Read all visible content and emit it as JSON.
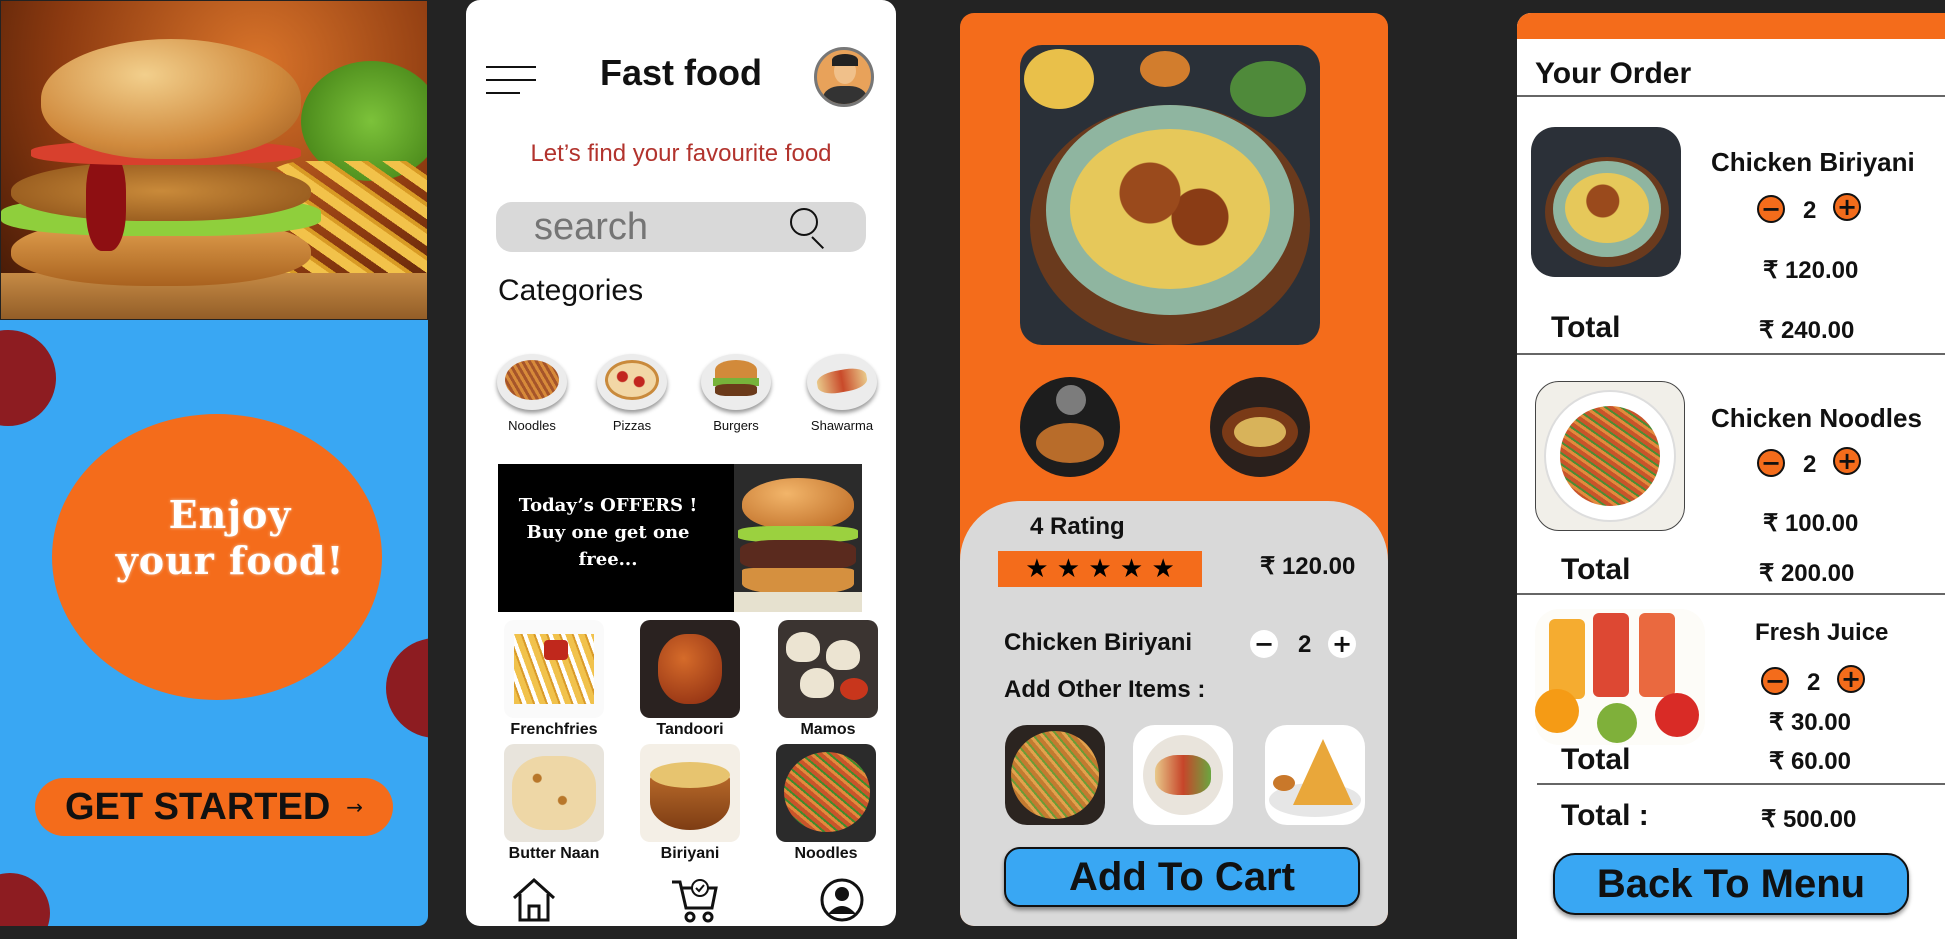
{
  "colors": {
    "orange": "#f46c1b",
    "blue": "#39a7f3",
    "red_text": "#b2332d",
    "dark_bg": "#232323"
  },
  "splash": {
    "headline_line1": "Enjoy",
    "headline_line2": "your food!",
    "cta_label": "GET STARTED",
    "cta_icon": "arrow-right-icon"
  },
  "home": {
    "title": "Fast food",
    "subtitle": "Let’s find your favourite food",
    "search_placeholder": "search",
    "categories_heading": "Categories",
    "categories": [
      {
        "label": "Noodles"
      },
      {
        "label": "Pizzas"
      },
      {
        "label": "Burgers"
      },
      {
        "label": "Shawarma"
      }
    ],
    "offer_line1": "Today’s  OFFERS !",
    "offer_line2": "Buy one get one",
    "offer_line3": "free...",
    "items": [
      {
        "label": "Frenchfries"
      },
      {
        "label": "Tandoori"
      },
      {
        "label": "Mamos"
      },
      {
        "label": "Butter Naan"
      },
      {
        "label": "Biriyani"
      },
      {
        "label": "Noodles"
      }
    ],
    "nav_icons": [
      "home-icon",
      "cart-icon",
      "profile-icon"
    ]
  },
  "detail": {
    "rating_label": "4  Rating",
    "stars": "★ ★ ★ ★ ★",
    "rating_value": 4,
    "price": "₹ 120.00",
    "dish_name": "Chicken Biriyani",
    "quantity": "2",
    "add_items_label": "Add Other Items :",
    "add_to_cart_label": "Add  To Cart"
  },
  "order": {
    "heading": "Your Order",
    "items": [
      {
        "name": "Chicken Biriyani",
        "qty": "2",
        "unit_price": "₹ 120.00",
        "total_label": "Total",
        "total": "₹ 240.00"
      },
      {
        "name": "Chicken  Noodles",
        "qty": "2",
        "unit_price": "₹ 100.00",
        "total_label": "Total",
        "total": "₹ 200.00"
      },
      {
        "name": "Fresh Juice",
        "qty": "2",
        "unit_price": "₹ 30.00",
        "total_label": "Total",
        "total": "₹ 60.00"
      }
    ],
    "grand_total_label": "Total :",
    "grand_total": "₹ 500.00",
    "back_label": "Back To Menu"
  }
}
